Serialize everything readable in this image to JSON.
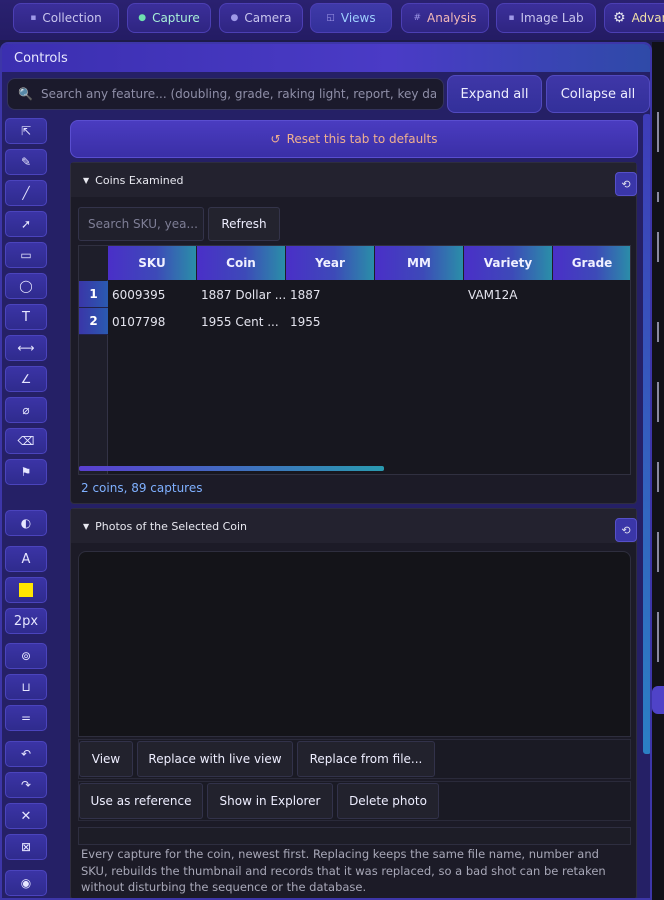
{
  "tabs": [
    {
      "label": "Collection",
      "icon": "▪"
    },
    {
      "label": "Capture",
      "icon": "●"
    },
    {
      "label": "Camera",
      "icon": "●"
    },
    {
      "label": "Views",
      "icon": "◱"
    },
    {
      "label": "Analysis",
      "icon": "#"
    },
    {
      "label": "Image Lab",
      "icon": "▪"
    },
    {
      "label": "Advan",
      "icon": "⚙"
    }
  ],
  "panel": {
    "title": "Controls"
  },
  "search": {
    "placeholder": "Search any feature... (doubling, grade, raking light, report, key dates)"
  },
  "buttons": {
    "expand_all": "Expand all",
    "collapse_all": "Collapse all"
  },
  "toolbar": {
    "text_label": "A",
    "stroke_width": "2px",
    "swatch_color": "#ffe600"
  },
  "reset": {
    "icon": "↺",
    "label": "Reset this tab to defaults"
  },
  "coins_section": {
    "title": "Coins Examined",
    "search_placeholder": "Search SKU, yea...",
    "refresh_label": "Refresh",
    "columns": [
      "SKU",
      "Coin",
      "Year",
      "MM",
      "Variety",
      "Grade"
    ],
    "rows": [
      {
        "num": "1",
        "sku": "6009395",
        "coin": "1887 Dollar ...",
        "year": "1887",
        "mm": "",
        "variety": "VAM12A",
        "grade": ""
      },
      {
        "num": "2",
        "sku": "0107798",
        "coin": "1955 Cent ...",
        "year": "1955",
        "mm": "",
        "variety": "",
        "grade": ""
      }
    ],
    "status": "2 coins, 89 captures"
  },
  "photos_section": {
    "title": "Photos of the Selected Coin",
    "buttons_row1": [
      "View",
      "Replace with live view",
      "Replace from file..."
    ],
    "buttons_row2": [
      "Use as reference",
      "Show in Explorer",
      "Delete photo"
    ],
    "description": "Every capture for the coin, newest first. Replacing keeps the same file name, number and SKU, rebuilds the thumbnail and records that it was replaced, so a bad shot can be retaken without disturbing the sequence or the database."
  },
  "colors": {
    "accent": "#4a3bc6",
    "header_gradient_end": "#2a8fa8",
    "status_text": "#7fb0ff",
    "reset_text": "#f0b090"
  }
}
